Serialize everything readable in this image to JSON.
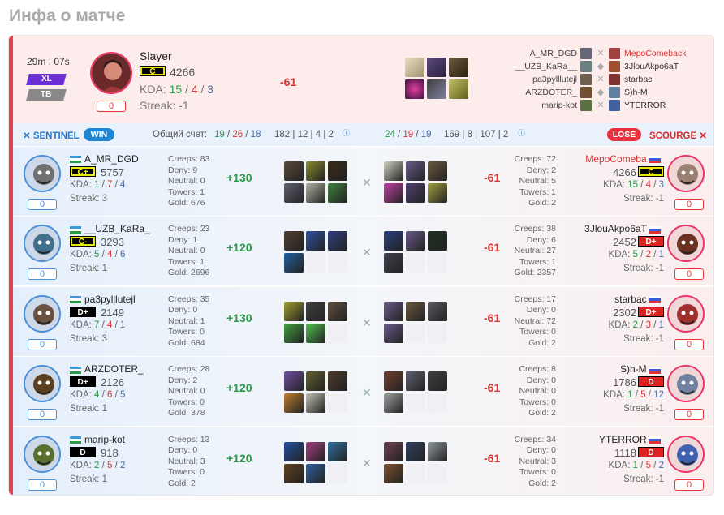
{
  "page_title": "Инфа о матче",
  "duration": "29m : 07s",
  "tags": {
    "xl": "XL",
    "tb": "TB"
  },
  "mvp": {
    "name": "Slayer",
    "rank": "C",
    "mmr": "4266",
    "kda_label": "KDA:",
    "k": "15",
    "d": "4",
    "a": "3",
    "streak": "Streak: -1",
    "delta": "-61",
    "btn": "0"
  },
  "right_list": [
    {
      "left": "A_MR_DGD",
      "right": "MepoComeback",
      "right_red": true
    },
    {
      "left": "__UZB_KaRa__",
      "right": "3JlouAkpo6aT",
      "right_red": false
    },
    {
      "left": "pa3pylllutejl",
      "right": "starbac",
      "right_red": false
    },
    {
      "left": "ARZDOTER_",
      "right": "S)h-M",
      "right_red": false
    },
    {
      "left": "marip-kot",
      "right": "YTERROR",
      "right_red": false
    }
  ],
  "header": {
    "sentinel": "SENTINEL",
    "win": "WIN",
    "total_label": "Общий счет:",
    "s_k": "19",
    "s_d": "26",
    "s_a": "18",
    "s_stats": "182 | 12 | 4 | 2",
    "c_k": "24",
    "c_d": "19",
    "c_a": "19",
    "c_stats": "169 | 8 | 107 | 2",
    "lose": "LOSE",
    "scourge": "SCOURGE"
  },
  "labels": {
    "kda": "KDA:",
    "creeps": "Creeps:",
    "deny": "Deny:",
    "neutral": "Neutral:",
    "towers": "Towers:",
    "gold": "Gold:",
    "slash": "/"
  },
  "rows": [
    {
      "l": {
        "name": "A_MR_DGD",
        "rank": "C+",
        "mmr": "5757",
        "k": "1",
        "d": "7",
        "a": "4",
        "streak": "Streak: 3",
        "btn": "0",
        "creeps": "83",
        "deny": "9",
        "neutral": "0",
        "towers": "1",
        "gold": "676",
        "delta": "+130"
      },
      "r": {
        "name": "MepoComeba",
        "rank": "C",
        "mmr": "4266",
        "k": "15",
        "d": "4",
        "a": "3",
        "streak": "Streak: -1",
        "btn": "0",
        "creeps": "72",
        "deny": "2",
        "neutral": "5",
        "towers": "1",
        "gold": "2",
        "delta": "-61"
      }
    },
    {
      "l": {
        "name": "__UZB_KaRa_",
        "rank": "C-",
        "mmr": "3293",
        "k": "5",
        "d": "4",
        "a": "6",
        "streak": "Streak: 1",
        "btn": "0",
        "creeps": "23",
        "deny": "1",
        "neutral": "0",
        "towers": "1",
        "gold": "2696",
        "delta": "+120"
      },
      "r": {
        "name": "3JlouAkpo6aT",
        "rank": "D+",
        "mmr": "2452",
        "k": "5",
        "d": "2",
        "a": "1",
        "streak": "Streak: -1",
        "btn": "0",
        "creeps": "38",
        "deny": "6",
        "neutral": "27",
        "towers": "1",
        "gold": "2357",
        "delta": "-61"
      }
    },
    {
      "l": {
        "name": "pa3pylllutejl",
        "rank": "D+",
        "mmr": "2149",
        "k": "7",
        "d": "4",
        "a": "1",
        "streak": "Streak: 3",
        "btn": "0",
        "creeps": "35",
        "deny": "0",
        "neutral": "1",
        "towers": "0",
        "gold": "684",
        "delta": "+130"
      },
      "r": {
        "name": "starbac",
        "rank": "D+",
        "mmr": "2302",
        "k": "2",
        "d": "3",
        "a": "1",
        "streak": "Streak: -1",
        "btn": "0",
        "creeps": "17",
        "deny": "0",
        "neutral": "72",
        "towers": "0",
        "gold": "2",
        "delta": "-61"
      }
    },
    {
      "l": {
        "name": "ARZDOTER_",
        "rank": "D+",
        "mmr": "2126",
        "k": "4",
        "d": "6",
        "a": "5",
        "streak": "Streak: 1",
        "btn": "0",
        "creeps": "28",
        "deny": "2",
        "neutral": "0",
        "towers": "0",
        "gold": "378",
        "delta": "+120"
      },
      "r": {
        "name": "S)h-M",
        "rank": "D",
        "mmr": "1786",
        "k": "1",
        "d": "5",
        "a": "12",
        "streak": "Streak: -1",
        "btn": "0",
        "creeps": "8",
        "deny": "0",
        "neutral": "0",
        "towers": "0",
        "gold": "2",
        "delta": "-61"
      }
    },
    {
      "l": {
        "name": "marip-kot",
        "rank": "D",
        "mmr": "918",
        "k": "2",
        "d": "5",
        "a": "2",
        "streak": "Streak: 1",
        "btn": "0",
        "creeps": "13",
        "deny": "0",
        "neutral": "3",
        "towers": "0",
        "gold": "2",
        "delta": "+120"
      },
      "r": {
        "name": "YTERROR",
        "rank": "D",
        "mmr": "1118",
        "k": "1",
        "d": "5",
        "a": "2",
        "streak": "Streak: -1",
        "btn": "0",
        "creeps": "34",
        "deny": "0",
        "neutral": "3",
        "towers": "0",
        "gold": "2",
        "delta": "-61"
      }
    }
  ],
  "colors": {
    "win": "#1f86d4",
    "lose": "#e8303e",
    "sentinel": "#2a76c7",
    "scourge": "#d92a2a",
    "accent_red": "#e8404e"
  }
}
